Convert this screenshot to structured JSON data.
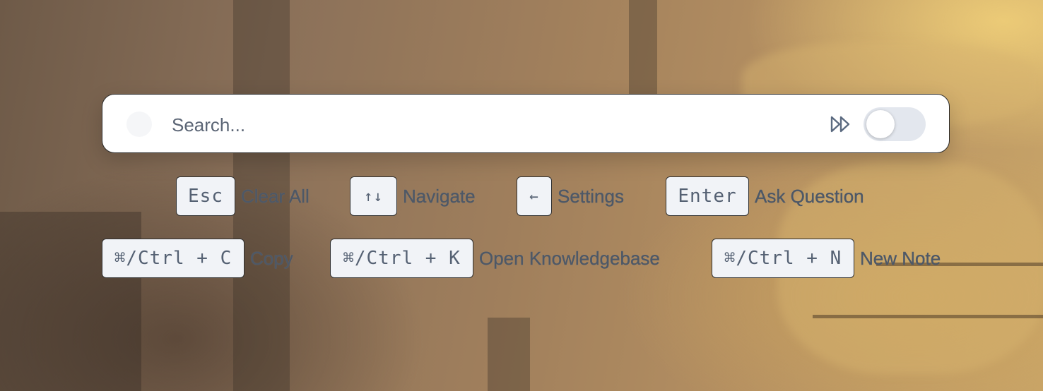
{
  "search": {
    "placeholder": "Search..."
  },
  "toggle": {
    "state": "off"
  },
  "shortcuts_row1": [
    {
      "key": "Esc",
      "label": "Clear All"
    },
    {
      "key": "↑↓",
      "label": "Navigate"
    },
    {
      "key": "←",
      "label": "Settings"
    },
    {
      "key": "Enter",
      "label": "Ask Question"
    }
  ],
  "shortcuts_row2": [
    {
      "key": "⌘/Ctrl + C",
      "label": "Copy"
    },
    {
      "key": "⌘/Ctrl + K",
      "label": "Open Knowledgebase"
    },
    {
      "key": "⌘/Ctrl + N",
      "label": "New Note"
    }
  ],
  "icons": {
    "search_leading": "circle-icon",
    "fast_forward": "fast-forward-icon"
  }
}
